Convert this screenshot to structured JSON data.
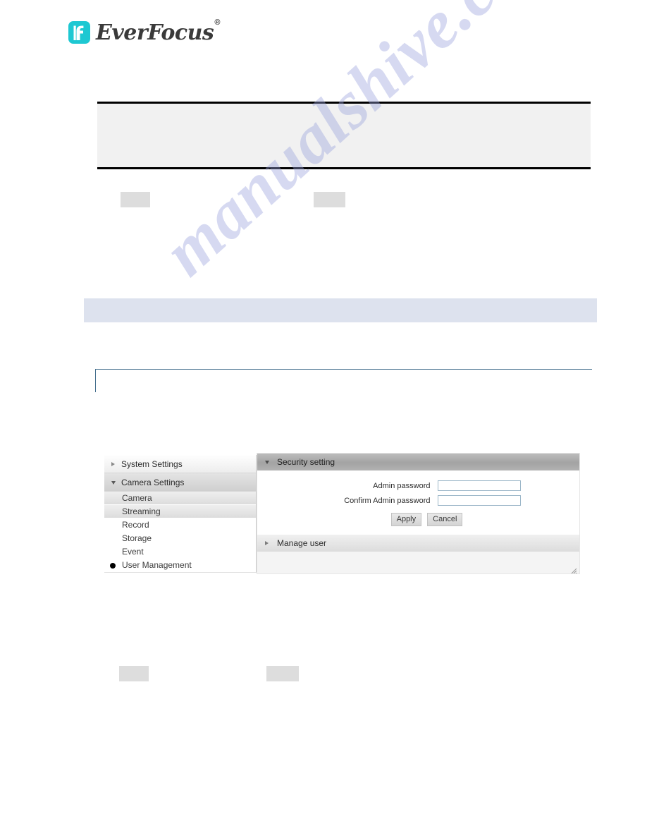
{
  "brand": {
    "name": "EverFocus",
    "registered_mark": "®",
    "logo_icon": "everfocus-f-logo-icon",
    "logo_color": "#1ec8d2"
  },
  "watermark": {
    "text": "manualshive.com",
    "color": "#9aa3dd"
  },
  "document": {
    "note_box": {
      "label": "",
      "background": "#f1f1f1",
      "border_color": "#000000"
    },
    "section_band": {
      "label": "",
      "background": "#dde2ee"
    },
    "bordered_block": {
      "label": "",
      "border_color": "#46708e"
    },
    "placeholder_chips": [
      {
        "name": "chip-upper-left",
        "label": ""
      },
      {
        "name": "chip-upper-right",
        "label": ""
      },
      {
        "name": "chip-lower-left",
        "label": ""
      },
      {
        "name": "chip-lower-right",
        "label": ""
      }
    ]
  },
  "webui": {
    "nav": {
      "groups": [
        {
          "label": "System Settings",
          "state": "collapsed",
          "arrow": "chevron-right-icon"
        },
        {
          "label": "Camera Settings",
          "state": "expanded",
          "arrow": "chevron-down-icon"
        }
      ],
      "items": [
        {
          "label": "Camera",
          "shaded": true,
          "marked": false
        },
        {
          "label": "Streaming",
          "shaded": true,
          "marked": false
        },
        {
          "label": "Record",
          "shaded": false,
          "marked": false
        },
        {
          "label": "Storage",
          "shaded": false,
          "marked": false
        },
        {
          "label": "Event",
          "shaded": false,
          "marked": false
        },
        {
          "label": "User Management",
          "shaded": false,
          "marked": true
        }
      ]
    },
    "panel": {
      "security_setting": {
        "title": "Security setting",
        "state": "expanded",
        "arrow": "chevron-down-icon",
        "fields": [
          {
            "label": "Admin password",
            "value": "",
            "placeholder": ""
          },
          {
            "label": "Confirm Admin password",
            "value": "",
            "placeholder": ""
          }
        ],
        "buttons": [
          {
            "label": "Apply",
            "name": "apply-button"
          },
          {
            "label": "Cancel",
            "name": "cancel-button"
          }
        ]
      },
      "manage_user": {
        "title": "Manage user",
        "state": "collapsed",
        "arrow": "chevron-right-icon"
      },
      "resize_grip": "resize-grip-icon"
    }
  }
}
